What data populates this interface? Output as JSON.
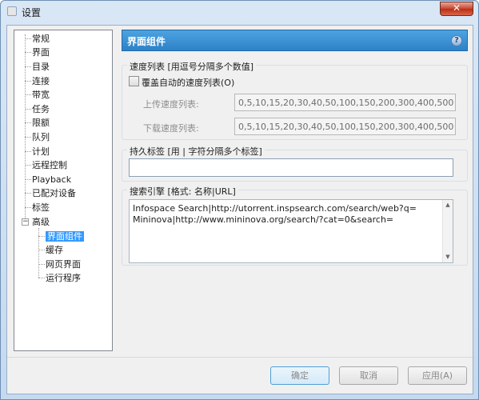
{
  "window": {
    "title": "设置",
    "close_glyph": "✕"
  },
  "tree": {
    "items": [
      {
        "label": "常规"
      },
      {
        "label": "界面"
      },
      {
        "label": "目录"
      },
      {
        "label": "连接"
      },
      {
        "label": "带宽"
      },
      {
        "label": "任务"
      },
      {
        "label": "限额"
      },
      {
        "label": "队列"
      },
      {
        "label": "计划"
      },
      {
        "label": "远程控制"
      },
      {
        "label": "Playback"
      },
      {
        "label": "已配对设备"
      },
      {
        "label": "标签"
      },
      {
        "label": "高级"
      }
    ],
    "children": [
      {
        "label": "界面组件"
      },
      {
        "label": "缓存"
      },
      {
        "label": "网页界面"
      },
      {
        "label": "运行程序"
      }
    ],
    "expander_glyph": "−"
  },
  "panel": {
    "title": "界面组件",
    "help_glyph": "?",
    "speed_group": {
      "legend": "速度列表 [用逗号分隔多个数值]",
      "override_label": "覆盖自动的速度列表(O)",
      "upload_label": "上传速度列表:",
      "upload_value": "0,5,10,15,20,30,40,50,100,150,200,300,400,500",
      "download_label": "下载速度列表:",
      "download_value": "0,5,10,15,20,30,40,50,100,150,200,300,400,500"
    },
    "tags_group": {
      "legend": "持久标签 [用 | 字符分隔多个标签]",
      "value": ""
    },
    "search_group": {
      "legend": "搜索引擎 [格式: 名称|URL]",
      "line1": "Infospace Search|http://utorrent.inspsearch.com/search/web?q=",
      "line2": "Mininova|http://www.mininova.org/search/?cat=0&search="
    }
  },
  "buttons": {
    "ok": "确定",
    "cancel": "取消",
    "apply": "应用(A)"
  }
}
